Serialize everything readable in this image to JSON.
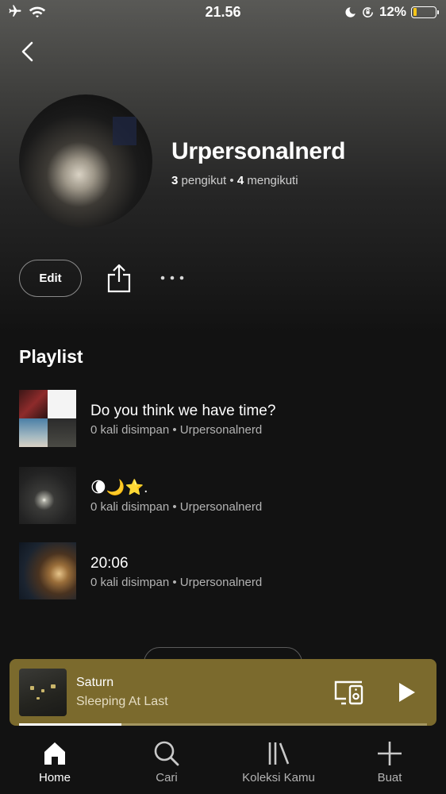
{
  "status_bar": {
    "time": "21.56",
    "battery_pct": "12%"
  },
  "profile": {
    "name": "Urpersonalnerd",
    "followers_count": "3",
    "followers_label": "pengikut",
    "separator": "•",
    "following_count": "4",
    "following_label": "mengikuti"
  },
  "actions": {
    "edit_label": "Edit"
  },
  "playlists": {
    "section_title": "Playlist",
    "items": [
      {
        "title": "Do you think we have time?",
        "subtitle": "0 kali disimpan • Urpersonalnerd"
      },
      {
        "title": "🌘🌙⭐.",
        "subtitle": "0 kali disimpan • Urpersonalnerd"
      },
      {
        "title": "20:06",
        "subtitle": "0 kali disimpan • Urpersonalnerd"
      }
    ]
  },
  "now_playing": {
    "title": "Saturn",
    "artist": "Sleeping At Last",
    "progress": 0.25,
    "bg_color": "#7b6a2d"
  },
  "nav": {
    "items": [
      {
        "label": "Home",
        "icon": "home-icon",
        "active": true
      },
      {
        "label": "Cari",
        "icon": "search-icon",
        "active": false
      },
      {
        "label": "Koleksi Kamu",
        "icon": "library-icon",
        "active": false
      },
      {
        "label": "Buat",
        "icon": "plus-icon",
        "active": false
      }
    ]
  }
}
